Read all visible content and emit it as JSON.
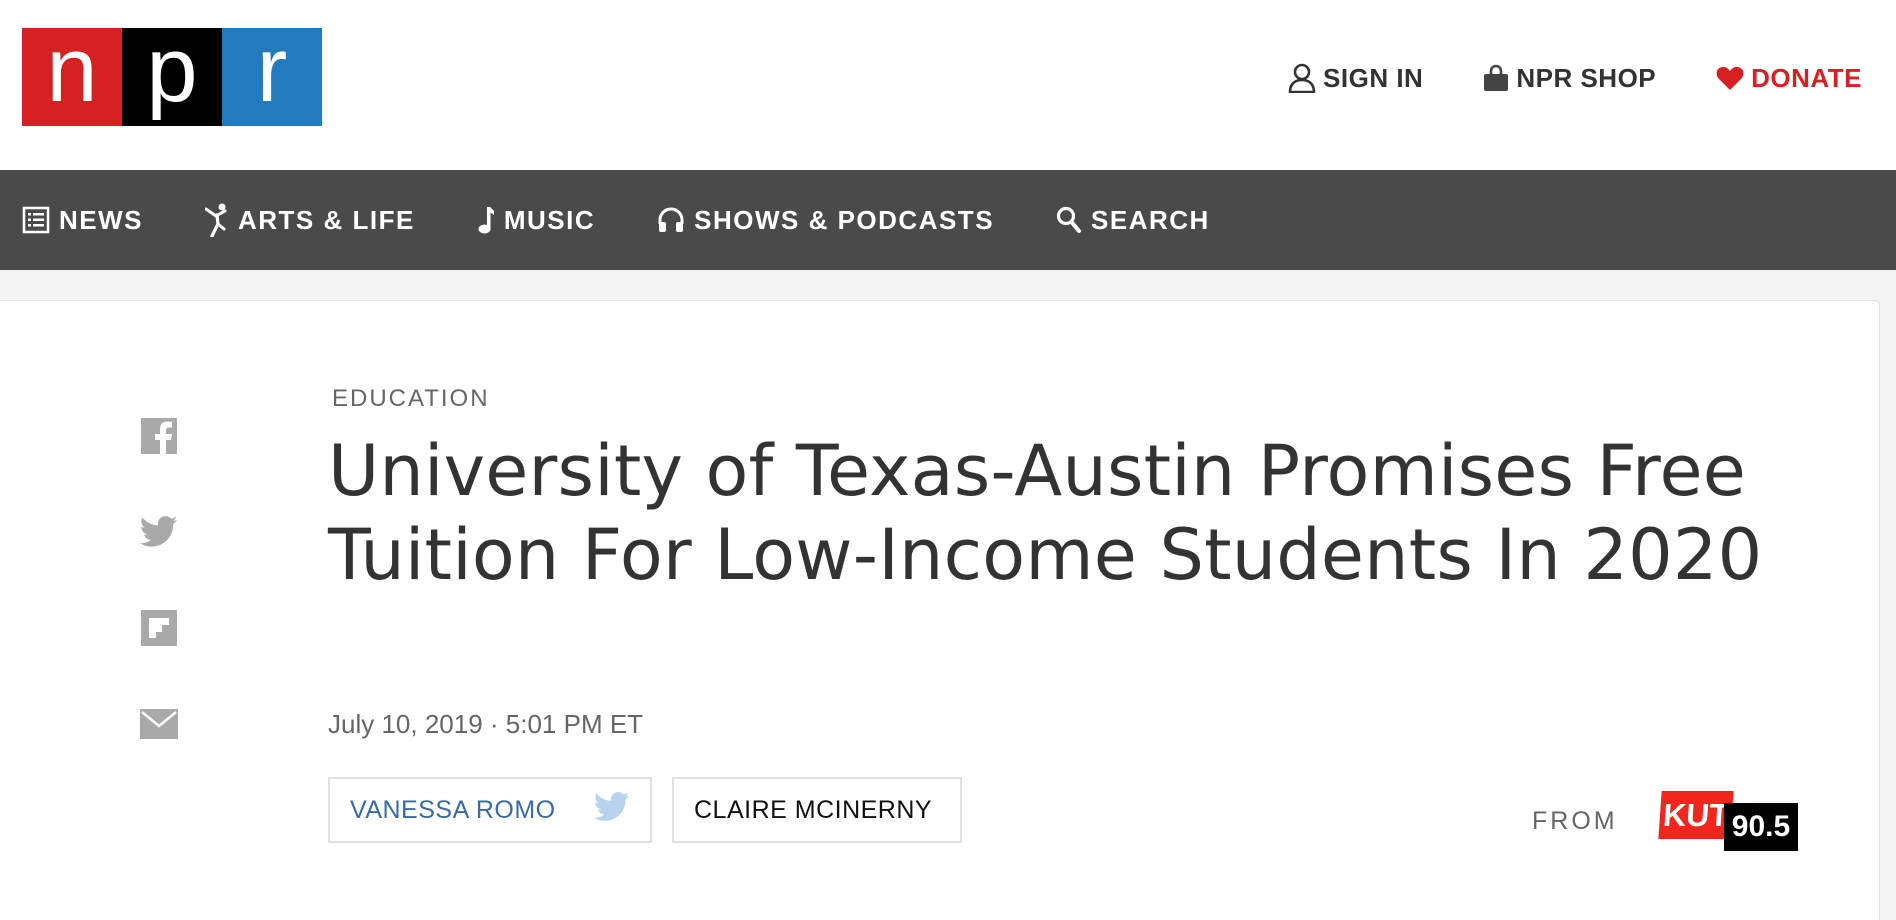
{
  "header": {
    "logo_letters": [
      "n",
      "p",
      "r"
    ],
    "sign_in_label": "SIGN IN",
    "shop_label": "NPR SHOP",
    "donate_label": "DONATE"
  },
  "nav": {
    "items": [
      {
        "label": "NEWS",
        "icon": "news-list-icon"
      },
      {
        "label": "ARTS & LIFE",
        "icon": "dancer-icon"
      },
      {
        "label": "MUSIC",
        "icon": "music-note-icon"
      },
      {
        "label": "SHOWS & PODCASTS",
        "icon": "headphones-icon"
      },
      {
        "label": "SEARCH",
        "icon": "search-icon"
      }
    ]
  },
  "share": {
    "icons": [
      "facebook-icon",
      "twitter-icon",
      "flipboard-icon",
      "email-icon"
    ]
  },
  "article": {
    "slug": "EDUCATION",
    "headline": "University of Texas-Austin Promises Free Tuition For Low-Income Students In 2020",
    "dateline": "July 10, 2019 · 5:01 PM ET",
    "bylines": [
      {
        "name": "VANESSA ROMO",
        "has_twitter": true
      },
      {
        "name": "CLAIRE MCINERNY",
        "has_twitter": false
      }
    ],
    "from_label": "FROM",
    "station": {
      "name": "KUT",
      "frequency": "90.5"
    }
  },
  "colors": {
    "npr_red": "#d62021",
    "npr_black": "#000000",
    "npr_blue": "#237bbd",
    "nav_bg": "#4a4a4a",
    "byline_link": "#3a6aa8",
    "kut_red": "#f2261c"
  }
}
